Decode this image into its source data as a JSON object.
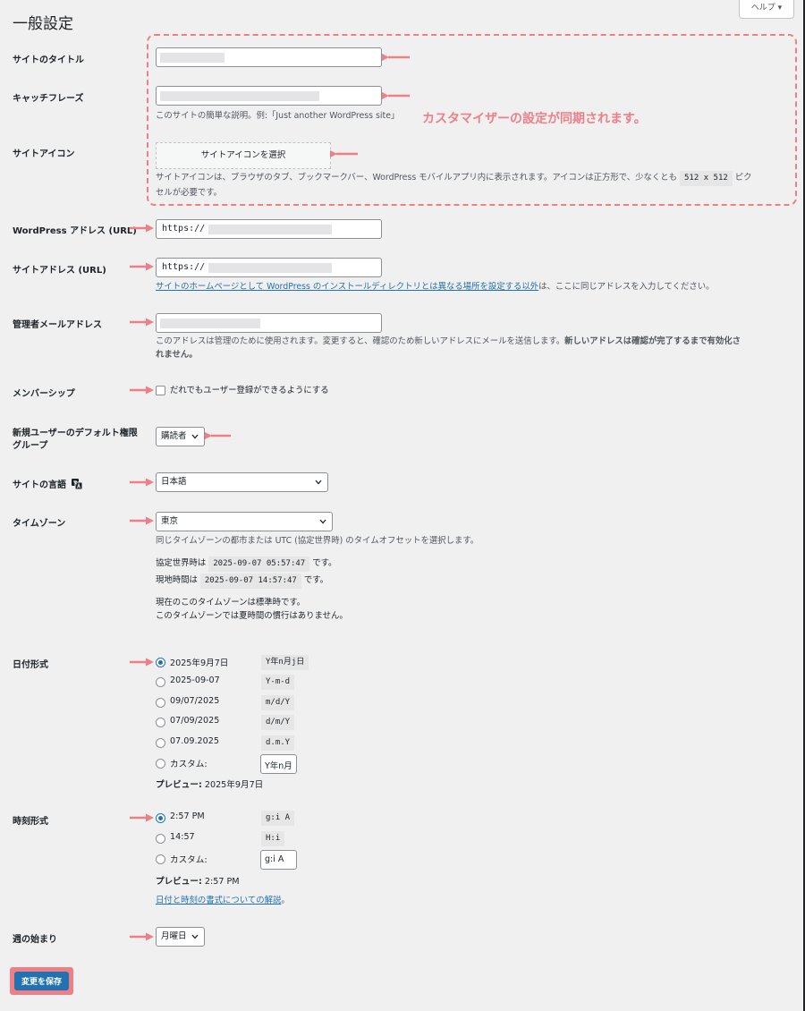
{
  "page": {
    "title": "一般設定",
    "help_tab": "ヘルプ ▾"
  },
  "annotations": {
    "callout": "カスタマイザーの設定が同期されます。",
    "color": "#ef7f87"
  },
  "fields": {
    "site_title": {
      "label": "サイトのタイトル"
    },
    "tagline": {
      "label": "キャッチフレーズ",
      "description": "このサイトの簡単な説明。例:「Just another WordPress site」"
    },
    "site_icon": {
      "label": "サイトアイコン",
      "button": "サイトアイコンを選択",
      "description_1": "サイトアイコンは、ブラウザのタブ、ブックマークバー、WordPress モバイルアプリ内に表示されます。アイコンは正方形で、少なくとも",
      "size_code": "512 x 512",
      "description_2": "ピク",
      "description_3": "セルが必要です。"
    },
    "wp_address": {
      "label": "WordPress アドレス (URL)",
      "value_prefix": "https://"
    },
    "site_address": {
      "label": "サイトアドレス (URL)",
      "value_prefix": "https://",
      "link_text": "サイトのホームページとして WordPress のインストールディレクトリとは異なる場所を設定する以外",
      "suffix_text": "は、ここに同じアドレスを入力してください。"
    },
    "admin_email": {
      "label": "管理者メールアドレス",
      "description_1": "このアドレスは管理のために使用されます。変更すると、確認のため新しいアドレスにメールを送信します。",
      "description_bold_1": "新しいアドレスは確認が完了するまで有効化さ",
      "description_bold_2": "れません。"
    },
    "membership": {
      "label": "メンバーシップ",
      "checkbox_label": "だれでもユーザー登録ができるようにする"
    },
    "default_role": {
      "label_1": "新規ユーザーのデフォルト権限",
      "label_2": "グループ",
      "selected": "購読者"
    },
    "site_language": {
      "label": "サイトの言語",
      "selected": "日本語"
    },
    "timezone": {
      "label": "タイムゾーン",
      "selected": "東京",
      "description": "同じタイムゾーンの都市または UTC (協定世界時) のタイムオフセットを選択します。",
      "utc_prefix": "協定世界時は",
      "utc_value": "2025-09-07 05:57:47",
      "utc_suffix": "です。",
      "local_prefix": "現地時間は",
      "local_value": "2025-09-07 14:57:47",
      "local_suffix": "です。",
      "note_1": "現在のこのタイムゾーンは標準時です。",
      "note_2": "このタイムゾーンでは夏時間の慣行はありません。"
    },
    "date_format": {
      "label": "日付形式",
      "options": [
        {
          "display": "2025年9月7日",
          "code": "Y年n月j日"
        },
        {
          "display": "2025-09-07",
          "code": "Y-m-d"
        },
        {
          "display": "09/07/2025",
          "code": "m/d/Y"
        },
        {
          "display": "07/09/2025",
          "code": "d/m/Y"
        },
        {
          "display": "07.09.2025",
          "code": "d.m.Y"
        }
      ],
      "custom_label": "カスタム:",
      "custom_value": "Y年n月",
      "preview_label": "プレビュー:",
      "preview_value": "2025年9月7日"
    },
    "time_format": {
      "label": "時刻形式",
      "options": [
        {
          "display": "2:57 PM",
          "code": "g:i A"
        },
        {
          "display": "14:57",
          "code": "H:i"
        }
      ],
      "custom_label": "カスタム:",
      "custom_value": "g:i A",
      "preview_label": "プレビュー:",
      "preview_value": "2:57 PM",
      "doc_link": "日付と時刻の書式についての解説",
      "doc_suffix": "。"
    },
    "week_start": {
      "label": "週の始まり",
      "selected": "月曜日"
    }
  },
  "actions": {
    "save": "変更を保存"
  },
  "colors": {
    "primary": "#2271b1",
    "annotation": "#ef7f87",
    "background": "#f0f0f1"
  }
}
